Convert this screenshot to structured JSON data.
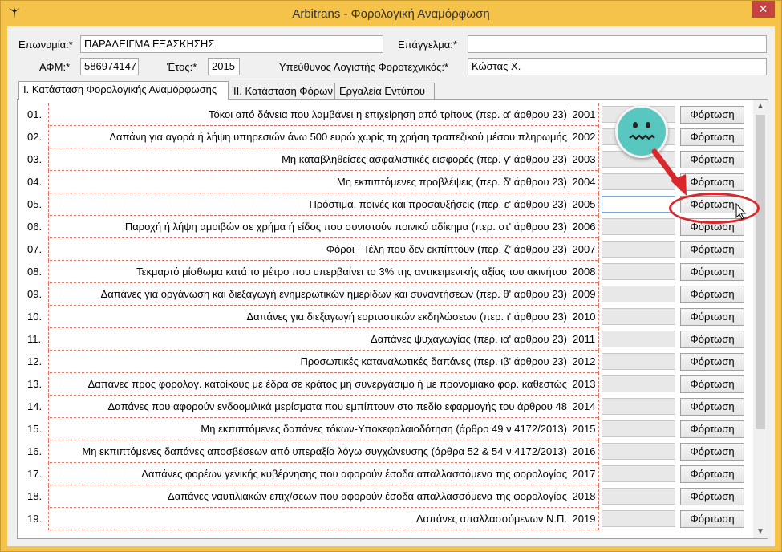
{
  "window": {
    "title": "Arbitrans - Φορολογική Αναμόρφωση",
    "close_label": "✕",
    "app_icon": "bird-logo-icon"
  },
  "form": {
    "company_label": "Επωνυμία:*",
    "company_value": "ΠΑΡΑΔΕΙΓΜΑ ΕΞΑΣΚΗΣΗΣ",
    "profession_label": "Επάγγελμα:*",
    "profession_value": "",
    "afm_label": "ΑΦΜ:*",
    "afm_value": "586974147",
    "year_label": "Έτος:*",
    "year_value": "2015",
    "accountant_label": "Υπεύθυνος Λογιστής Φοροτεχνικός:*",
    "accountant_value": "Κώστας Χ."
  },
  "tabs": [
    {
      "label": "I. Κατάσταση Φορολογικής Αναμόρφωσης",
      "active": true
    },
    {
      "label": "II. Κατάσταση Φόρων",
      "active": false
    },
    {
      "label": "Εργαλεία Εντύπου",
      "active": false
    }
  ],
  "load_button_label": "Φόρτωση",
  "rows": [
    {
      "num": "01.",
      "desc": "Τόκοι από δάνεια που λαμβάνει η επιχείρηση από τρίτους (περ. α' άρθρου 23)",
      "code": "2001"
    },
    {
      "num": "02.",
      "desc": "Δαπάνη για αγορά ή λήψη υπηρεσιών άνω 500 ευρώ χωρίς τη χρήση τραπεζικού μέσου πληρωμής",
      "code": "2002"
    },
    {
      "num": "03.",
      "desc": "Μη καταβληθείσες ασφαλιστικές εισφορές (περ. γ' άρθρου 23)",
      "code": "2003"
    },
    {
      "num": "04.",
      "desc": "Μη εκπιπτόμενες προβλέψεις (περ. δ' άρθρου 23)",
      "code": "2004"
    },
    {
      "num": "05.",
      "desc": "Πρόστιμα, ποινές και προσαυξήσεις (περ. ε' άρθρου 23)",
      "code": "2005"
    },
    {
      "num": "06.",
      "desc": "Παροχή ή λήψη αμοιβών σε χρήμα ή είδος που συνιστούν ποινικό αδίκημα (περ. στ' άρθρου 23)",
      "code": "2006"
    },
    {
      "num": "07.",
      "desc": "Φόροι - Τέλη που δεν εκπίπτουν (περ. ζ' άρθρου 23)",
      "code": "2007"
    },
    {
      "num": "08.",
      "desc": "Τεκμαρτό μίσθωμα κατά το μέτρο που υπερβαίνει το 3% της αντικειμενικής αξίας του ακινήτου",
      "code": "2008"
    },
    {
      "num": "09.",
      "desc": "Δαπάνες για οργάνωση και διεξαγωγή ενημερωτικών ημερίδων και συναντήσεων (περ. θ' άρθρου 23)",
      "code": "2009"
    },
    {
      "num": "10.",
      "desc": "Δαπάνες για διεξαγωγή εορταστικών εκδηλώσεων (περ. ι' άρθρου 23)",
      "code": "2010"
    },
    {
      "num": "11.",
      "desc": "Δαπάνες ψυχαγωγίας (περ. ια' άρθρου 23)",
      "code": "2011"
    },
    {
      "num": "12.",
      "desc": "Προσωπικές καταναλωτικές δαπάνες (περ. ιβ' άρθρου 23)",
      "code": "2012"
    },
    {
      "num": "13.",
      "desc": "Δαπάνες προς φορολογ. κατοίκους με έδρα σε κράτος μη συνεργάσιμο ή με προνομιακό φορ. καθεστώς",
      "code": "2013"
    },
    {
      "num": "14.",
      "desc": "Δαπάνες που αφορούν ενδοομιλικά μερίσματα που εμπίπτουν στο πεδίο εφαρμογής του άρθρου 48",
      "code": "2014"
    },
    {
      "num": "15.",
      "desc": "Μη εκπιπτόμενες δαπάνες τόκων-Υποκεφαλαιοδότηση (άρθρο 49 ν.4172/2013)",
      "code": "2015"
    },
    {
      "num": "16.",
      "desc": "Μη εκπιπτόμενες δαπάνες αποσβέσεων από υπεραξία λόγω συγχώνευσης (άρθρα 52 & 54 ν.4172/2013)",
      "code": "2016"
    },
    {
      "num": "17.",
      "desc": "Δαπάνες φορέων γενικής κυβέρνησης που αφορούν έσοδα απαλλασσόμενα της φορολογίας",
      "code": "2017"
    },
    {
      "num": "18.",
      "desc": "Δαπάνες ναυτιλιακών επιχ/σεων που αφορούν έσοδα απαλλασσόμενα της φορολογίας",
      "code": "2018"
    },
    {
      "num": "19.",
      "desc": "Δαπάνες απαλλασσόμενων Ν.Π.",
      "code": "2019"
    }
  ],
  "annotation": {
    "smiley_icon": "smiley-face-icon",
    "arrow_icon": "red-arrow-icon",
    "highlight_color": "#d9282b"
  }
}
